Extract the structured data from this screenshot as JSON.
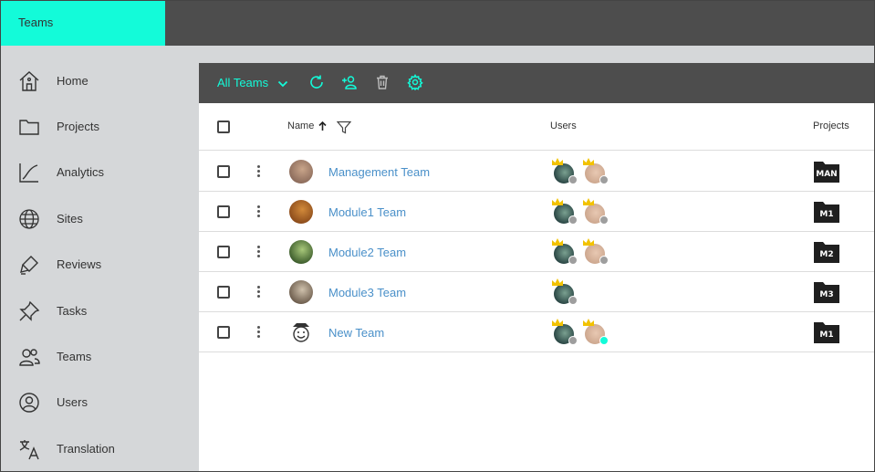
{
  "app": {
    "title": "Teams"
  },
  "colors": {
    "accent": "#13fbd9",
    "topbar": "#4d4d4d",
    "sidebar": "#d5d7d9",
    "link": "#4a90c9"
  },
  "sidebar": {
    "items": [
      {
        "label": "Home",
        "icon": "home-icon"
      },
      {
        "label": "Projects",
        "icon": "folder-icon"
      },
      {
        "label": "Analytics",
        "icon": "analytics-icon"
      },
      {
        "label": "Sites",
        "icon": "globe-icon"
      },
      {
        "label": "Reviews",
        "icon": "pen-icon"
      },
      {
        "label": "Tasks",
        "icon": "pin-icon"
      },
      {
        "label": "Teams",
        "icon": "people-icon"
      },
      {
        "label": "Users",
        "icon": "user-circle-icon"
      },
      {
        "label": "Translation",
        "icon": "translate-icon"
      }
    ]
  },
  "toolbar": {
    "filter_label": "All Teams",
    "buttons": [
      "refresh-icon",
      "add-user-icon",
      "trash-icon",
      "gear-icon"
    ]
  },
  "table": {
    "columns": {
      "name": "Name",
      "users": "Users",
      "projects": "Projects"
    },
    "sort": "ascending",
    "rows": [
      {
        "name": "Management Team",
        "project": "MAN",
        "users": [
          {
            "crown": true,
            "status": "offline"
          },
          {
            "crown": true,
            "status": "offline"
          }
        ]
      },
      {
        "name": "Module1 Team",
        "project": "M1",
        "users": [
          {
            "crown": true,
            "status": "offline"
          },
          {
            "crown": true,
            "status": "offline"
          }
        ]
      },
      {
        "name": "Module2 Team",
        "project": "M2",
        "users": [
          {
            "crown": true,
            "status": "offline"
          },
          {
            "crown": true,
            "status": "offline"
          }
        ]
      },
      {
        "name": "Module3 Team",
        "project": "M3",
        "users": [
          {
            "crown": true,
            "status": "offline"
          }
        ]
      },
      {
        "name": "New Team",
        "project": "M1",
        "users": [
          {
            "crown": true,
            "status": "offline"
          },
          {
            "crown": true,
            "status": "online"
          }
        ]
      }
    ]
  },
  "status_colors": {
    "offline": "#9e9e9e",
    "online": "#13fbd9"
  }
}
